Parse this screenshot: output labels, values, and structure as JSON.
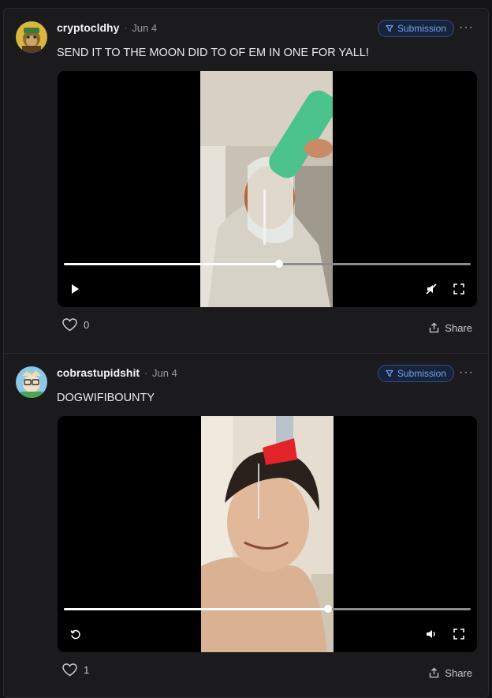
{
  "posts": [
    {
      "username": "cryptocldhy",
      "separator": "·",
      "date": "Jun 4",
      "badge": "Submission",
      "more": "···",
      "text": "SEND IT TO THE MOON DID TO OF EM IN ONE FOR YALL!",
      "video": {
        "progress": 0.53,
        "play_state": "paused",
        "sound": "muted"
      },
      "likes": "0",
      "share_label": "Share",
      "avatar_icon": "monkey-avatar-icon"
    },
    {
      "username": "cobrastupidshit",
      "separator": "·",
      "date": "Jun 4",
      "badge": "Submission",
      "more": "···",
      "text": "DOGWIFIBOUNTY",
      "video": {
        "progress": 0.65,
        "play_state": "ended",
        "sound": "on"
      },
      "likes": "1",
      "share_label": "Share",
      "avatar_icon": "cartoon-avatar-icon"
    }
  ],
  "colors": {
    "accent": "#6fa2f2",
    "badge_border": "#2e4f86",
    "background": "#1b1b1e"
  }
}
